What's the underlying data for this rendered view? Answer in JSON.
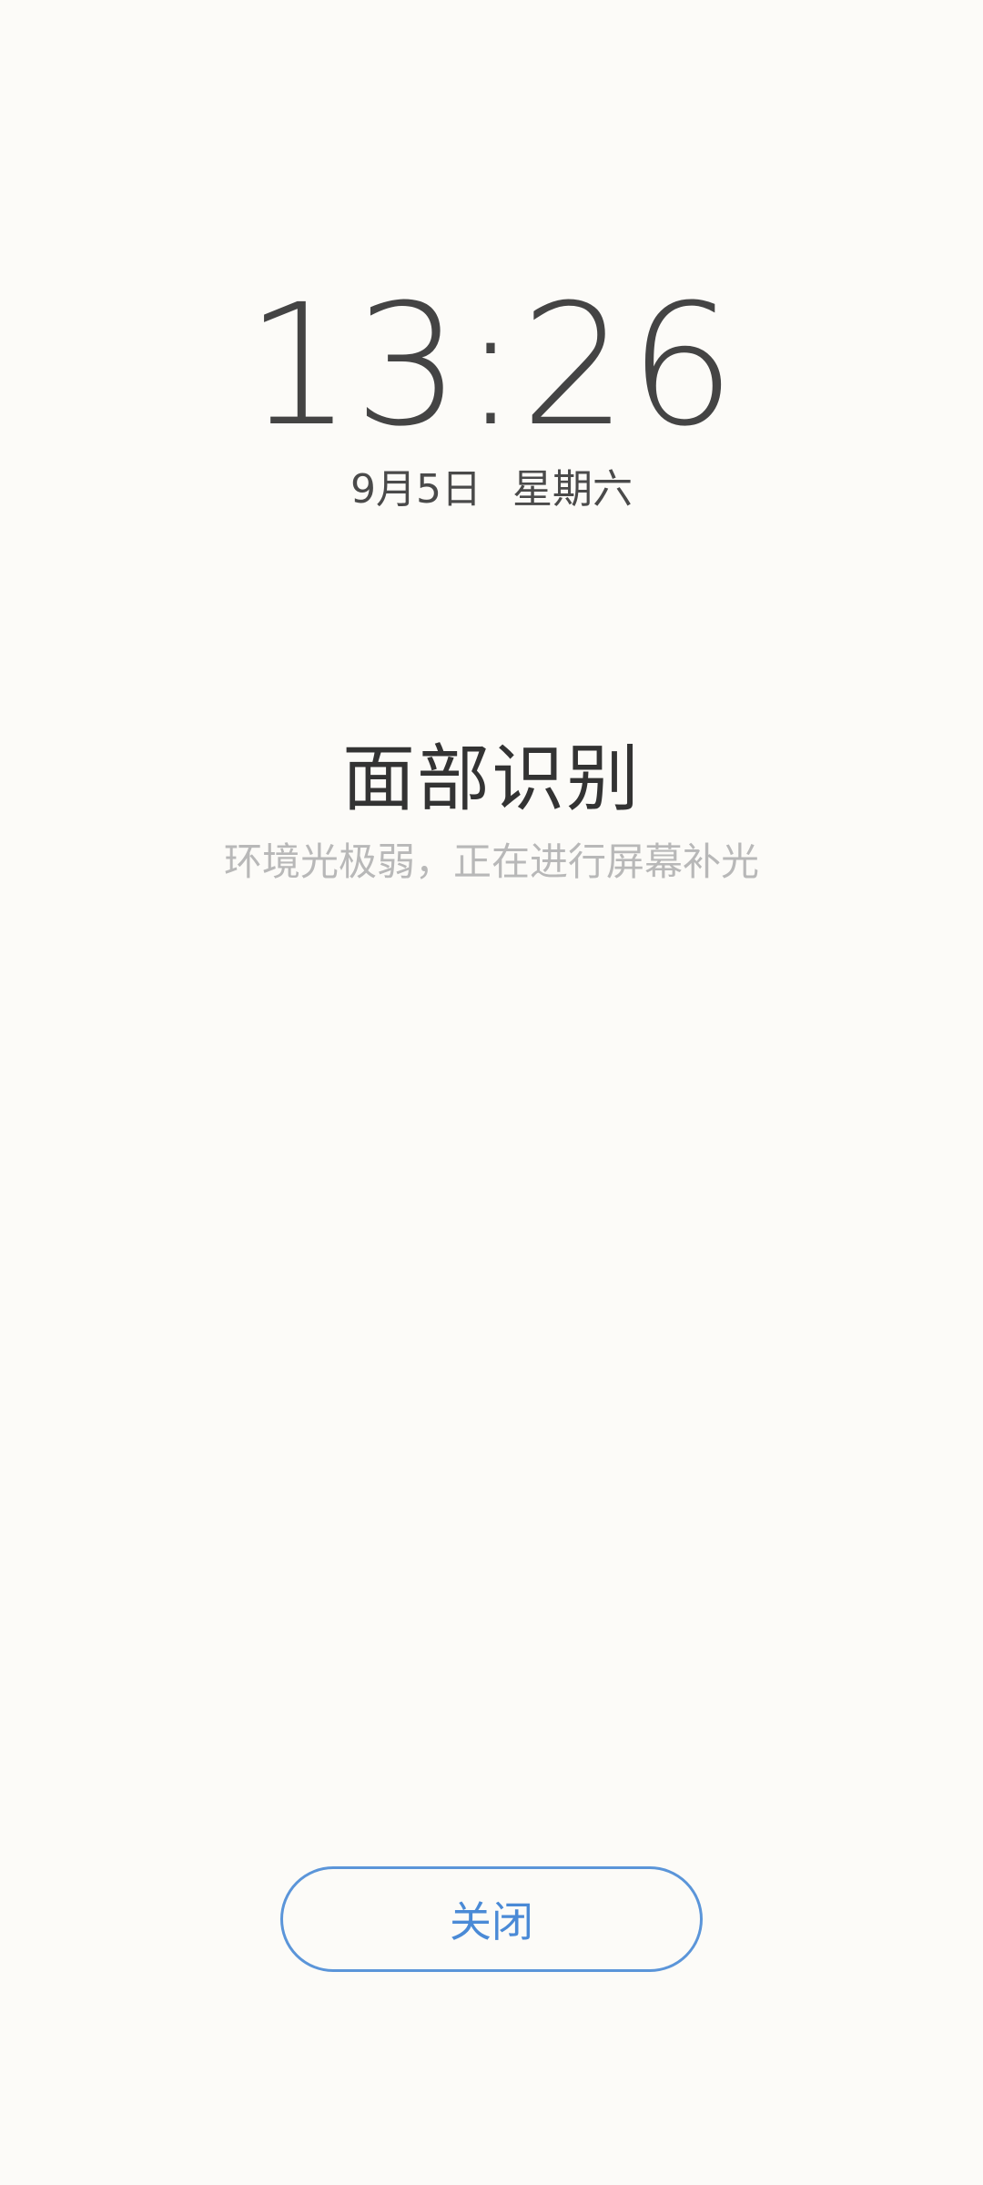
{
  "lockscreen": {
    "time": "13:26",
    "date": "9月5日",
    "weekday": "星期六"
  },
  "face_unlock": {
    "title": "面部识别",
    "subtitle": "环境光极弱，正在进行屏幕补光",
    "close_label": "关闭"
  },
  "colors": {
    "background": "#fcfbf8",
    "accent": "#4a8ad6",
    "text_primary": "#333333",
    "text_secondary": "#b8b8b8"
  }
}
